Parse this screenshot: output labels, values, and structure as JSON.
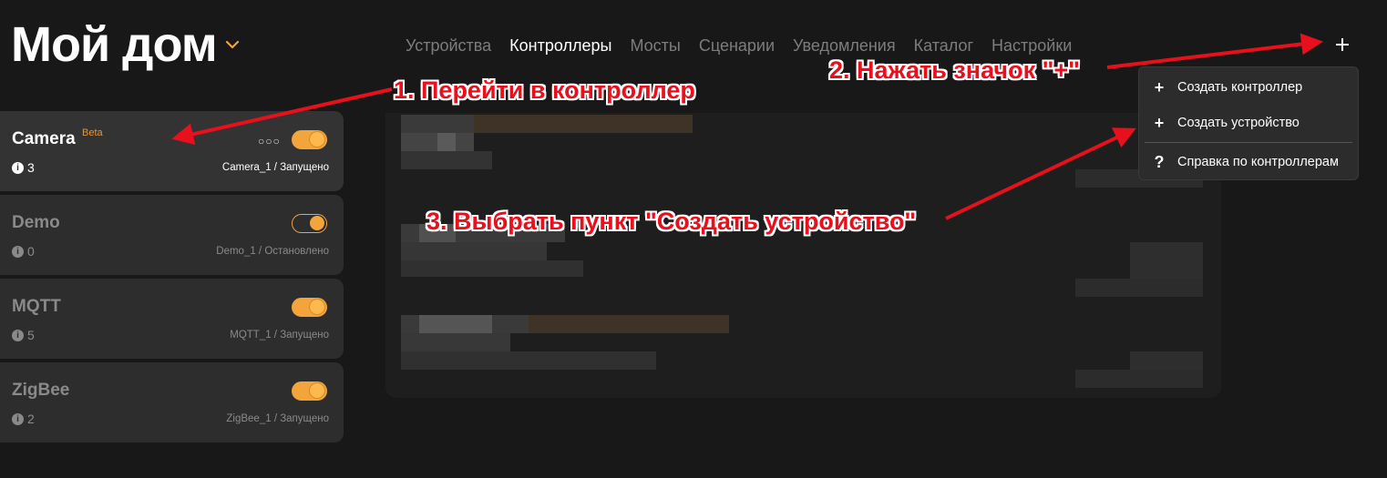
{
  "header": {
    "title": "Мой дом"
  },
  "nav": {
    "items": [
      {
        "label": "Устройства"
      },
      {
        "label": "Контроллеры"
      },
      {
        "label": "Мосты"
      },
      {
        "label": "Сценарии"
      },
      {
        "label": "Уведомления"
      },
      {
        "label": "Каталог"
      },
      {
        "label": "Настройки"
      }
    ],
    "active": "Контроллеры"
  },
  "controllers": [
    {
      "name": "Camera",
      "badge": "Beta",
      "count": "3",
      "status": "Camera_1 / Запущено",
      "enabled": true,
      "selected": true
    },
    {
      "name": "Demo",
      "badge": "",
      "count": "0",
      "status": "Demo_1 / Остановлено",
      "enabled": false,
      "selected": false
    },
    {
      "name": "MQTT",
      "badge": "",
      "count": "5",
      "status": "MQTT_1 / Запущено",
      "enabled": true,
      "selected": false
    },
    {
      "name": "ZigBee",
      "badge": "",
      "count": "2",
      "status": "ZigBee_1 / Запущено",
      "enabled": true,
      "selected": false
    }
  ],
  "dropdown": {
    "items": [
      {
        "icon": "+",
        "label": "Создать контроллер"
      },
      {
        "icon": "+",
        "label": "Создать устройство"
      },
      {
        "icon": "?",
        "label": "Справка по контроллерам"
      }
    ]
  },
  "annotations": {
    "step1": "1. Перейти в контроллер",
    "step2": "2. Нажать значок \"+\"",
    "step3": "3. Выбрать пункт \"Создать устройство\""
  },
  "colors": {
    "accent": "#f3a43a",
    "annotation": "#e8101c",
    "background": "#181818"
  },
  "icons": {
    "title_chevron": "chevron-down-icon",
    "add": "plus-icon",
    "info": "info-icon",
    "more": "more-dots-icon"
  }
}
